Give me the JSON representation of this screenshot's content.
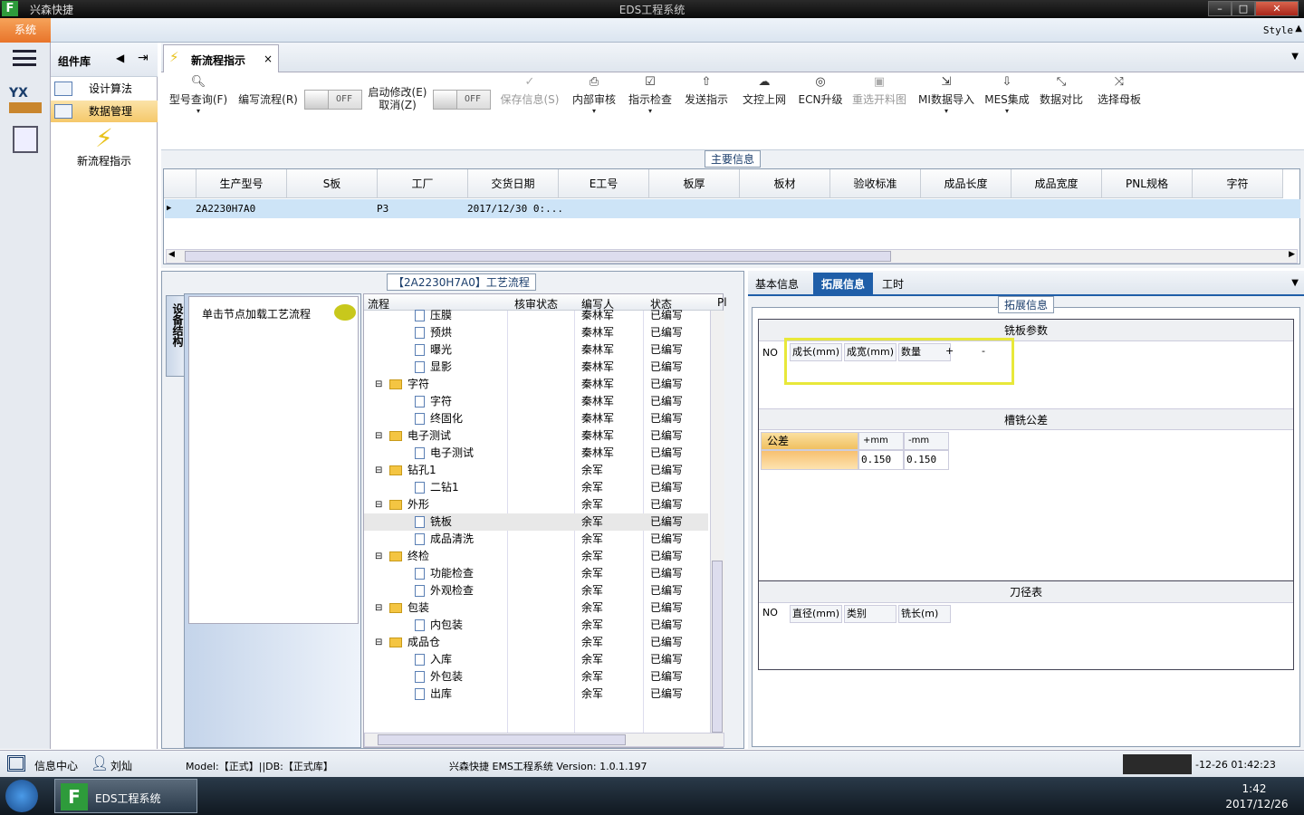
{
  "window": {
    "title": "EDS工程系统",
    "app_name": "兴森快捷",
    "logo": "F"
  },
  "menubar": {
    "system_label": "系统",
    "style_label": "Style"
  },
  "component_panel": {
    "title": "组件库",
    "items": [
      {
        "label": "设计算法"
      },
      {
        "label": "数据管理"
      }
    ],
    "big_button_label": "新流程指示"
  },
  "tab": {
    "label": "新流程指示",
    "close": "×"
  },
  "toolbar": {
    "buttons": [
      {
        "label": "型号查询(F)",
        "icon": "search-icon"
      },
      {
        "label": "编写流程(R)",
        "icon": ""
      },
      {
        "label": "启动修改(E)",
        "icon": ""
      },
      {
        "label": "取消(Z)",
        "icon": ""
      },
      {
        "label": "保存信息(S)",
        "icon": "check-icon"
      },
      {
        "label": "内部审核",
        "icon": "print-icon"
      },
      {
        "label": "指示检查",
        "icon": "checkbox-icon"
      },
      {
        "label": "发送指示",
        "icon": "upload-icon"
      },
      {
        "label": "文控上网",
        "icon": "cloud-icon"
      },
      {
        "label": "ECN升级",
        "icon": "binoculars-icon"
      },
      {
        "label": "重选开料图",
        "icon": "image-icon"
      },
      {
        "label": "MI数据导入",
        "icon": "import-icon"
      },
      {
        "label": "MES集成",
        "icon": "download-icon"
      },
      {
        "label": "数据对比",
        "icon": "compare-icon"
      },
      {
        "label": "选择母板",
        "icon": "shuffle-icon"
      }
    ],
    "toggle1": "OFF",
    "toggle2": "OFF"
  },
  "main_info": {
    "group_label": "主要信息",
    "columns": [
      "生产型号",
      "S板",
      "工厂",
      "交货日期",
      "E工号",
      "板厚",
      "板材",
      "验收标准",
      "成品长度",
      "成品宽度",
      "PNL规格",
      "字符"
    ],
    "row": {
      "model": "2A2230H7A0",
      "factory": "P3",
      "date": "2017/12/30 0:..."
    }
  },
  "process": {
    "group_label": "【2A2230H7A0】工艺流程",
    "side_tab": "设备结构",
    "hint": "单击节点加载工艺流程",
    "columns": [
      "流程",
      "核审状态",
      "编写人",
      "状态",
      "Pl"
    ],
    "rows": [
      {
        "name": "压膜",
        "editor": "秦林军",
        "status": "已编写",
        "type": "doc",
        "partial": true
      },
      {
        "name": "预烘",
        "editor": "秦林军",
        "status": "已编写",
        "type": "doc"
      },
      {
        "name": "曝光",
        "editor": "秦林军",
        "status": "已编写",
        "type": "doc"
      },
      {
        "name": "显影",
        "editor": "秦林军",
        "status": "已编写",
        "type": "doc"
      },
      {
        "name": "字符",
        "editor": "秦林军",
        "status": "已编写",
        "type": "folder"
      },
      {
        "name": "字符",
        "editor": "秦林军",
        "status": "已编写",
        "type": "doc"
      },
      {
        "name": "终固化",
        "editor": "秦林军",
        "status": "已编写",
        "type": "doc"
      },
      {
        "name": "电子测试",
        "editor": "秦林军",
        "status": "已编写",
        "type": "folder"
      },
      {
        "name": "电子测试",
        "editor": "秦林军",
        "status": "已编写",
        "type": "doc"
      },
      {
        "name": "钻孔1",
        "editor": "余军",
        "status": "已编写",
        "type": "folder"
      },
      {
        "name": "二钻1",
        "editor": "余军",
        "status": "已编写",
        "type": "doc"
      },
      {
        "name": "外形",
        "editor": "余军",
        "status": "已编写",
        "type": "folder"
      },
      {
        "name": "铣板",
        "editor": "余军",
        "status": "已编写",
        "type": "doc",
        "selected": true
      },
      {
        "name": "成品清洗",
        "editor": "余军",
        "status": "已编写",
        "type": "doc"
      },
      {
        "name": "终检",
        "editor": "余军",
        "status": "已编写",
        "type": "folder"
      },
      {
        "name": "功能检查",
        "editor": "余军",
        "status": "已编写",
        "type": "doc"
      },
      {
        "name": "外观检查",
        "editor": "余军",
        "status": "已编写",
        "type": "doc"
      },
      {
        "name": "包装",
        "editor": "余军",
        "status": "已编写",
        "type": "folder"
      },
      {
        "name": "内包装",
        "editor": "余军",
        "status": "已编写",
        "type": "doc"
      },
      {
        "name": "成品仓",
        "editor": "余军",
        "status": "已编写",
        "type": "folder"
      },
      {
        "name": "入库",
        "editor": "余军",
        "status": "已编写",
        "type": "doc"
      },
      {
        "name": "外包装",
        "editor": "余军",
        "status": "已编写",
        "type": "doc"
      },
      {
        "name": "出库",
        "editor": "余军",
        "status": "已编写",
        "type": "doc"
      }
    ]
  },
  "right_tabs": [
    "基本信息",
    "拓展信息",
    "工时"
  ],
  "ext": {
    "group_label": "拓展信息",
    "milling_params": {
      "title": "铣板参数",
      "cols": [
        "NO",
        "成长(mm)",
        "成宽(mm)",
        "数量",
        "+",
        "-"
      ]
    },
    "slot_tolerance": {
      "title": "槽铣公差",
      "label": "公差",
      "plus_hdr": "+mm",
      "minus_hdr": "-mm",
      "plus": "0.150",
      "minus": "0.150"
    },
    "tool_table": {
      "title": "刀径表",
      "cols": [
        "NO",
        "直径(mm)",
        "类别",
        "铣长(m)"
      ]
    }
  },
  "status": {
    "info_center": "信息中心",
    "user": "刘灿",
    "model_db": "Model:【正式】||DB:【正式库】",
    "version": "兴森快捷 EMS工程系统 Version: 1.0.1.197",
    "datetime": "-12-26 01:42:23"
  },
  "taskbar": {
    "app": "EDS工程系统",
    "time": "1:42",
    "date": "2017/12/26"
  },
  "colors": {
    "accent_orange": "#e8742a",
    "selection_blue": "#cde4f7",
    "highlight_yellow": "#e8e83a"
  }
}
